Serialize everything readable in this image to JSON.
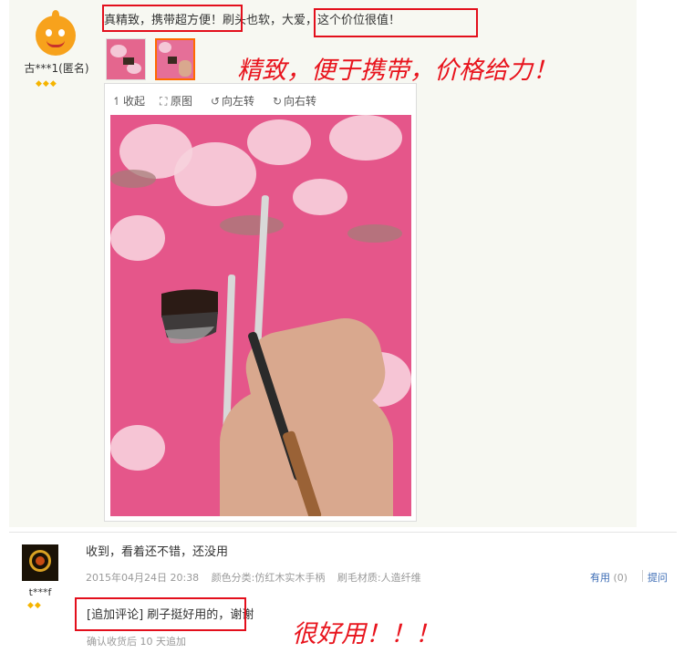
{
  "review1": {
    "username": "古***1(匿名)",
    "gems": "◆◆◆",
    "text_part1": "真精致，携带超方便！",
    "text_part2": "刷头也软，",
    "text_part3": "大爱，这个价位很值！",
    "annotation": "精致，便于携带，价格给力！",
    "viewer": {
      "collapse_label": "收起",
      "original_label": "原图",
      "rotate_left_label": "向左转",
      "rotate_right_label": "向右转"
    }
  },
  "review2": {
    "username": "t***f",
    "gems": "◆◆",
    "text": "收到，看着还不错，还没用",
    "date": "2015年04月24日 20:38",
    "color_category": "颜色分类:仿红木实木手柄",
    "bristle_material": "刷毛材质:人造纤维",
    "useful_label": "有用",
    "useful_count": "(0)",
    "reply_label": "提问",
    "followup_tag": "[追加评论]",
    "followup_text": "刷子挺好用的，",
    "followup_tail": "谢谢",
    "annotation": "很好用！！！",
    "followup_meta": "确认收货后 10 天追加"
  },
  "colors": {
    "highlight_red": "#e30f1c",
    "link_blue": "#3c6cb5",
    "gem_gold": "#f5b400"
  }
}
